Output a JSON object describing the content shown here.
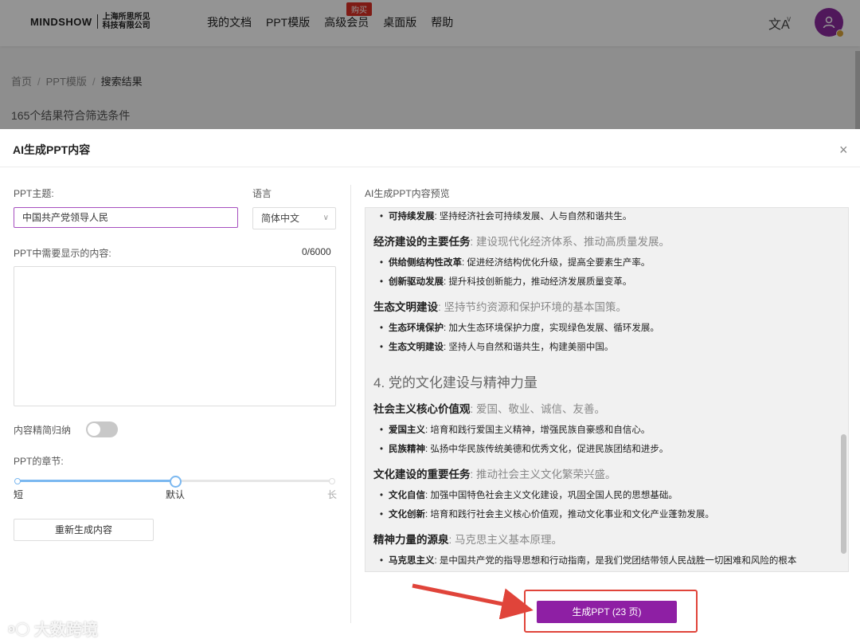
{
  "header": {
    "logo_brand": "MINDSHOW",
    "logo_company_line1": "上海所思所见",
    "logo_company_line2": "科技有限公司",
    "nav": [
      "我的文档",
      "PPT模版",
      "高级会员",
      "桌面版",
      "帮助"
    ],
    "buy_badge": "购买",
    "lang_icon": "文A",
    "lang_chevron": "∨"
  },
  "breadcrumb": {
    "home": "首页",
    "templates": "PPT模版",
    "current": "搜索结果"
  },
  "results": {
    "count_text": "165个结果符合筛选条件"
  },
  "modal": {
    "title": "AI生成PPT内容",
    "close": "×",
    "topic_label": "PPT主题:",
    "topic_value": "中国共产党领导人民",
    "language_label": "语言",
    "language_value": "简体中文",
    "content_label": "PPT中需要显示的内容:",
    "content_counter": "0/6000",
    "content_value": "",
    "simplify_label": "内容精简归纳",
    "simplify_on": false,
    "chapters_label": "PPT的章节:",
    "chapters_ticks": [
      "短",
      "默认",
      "长"
    ],
    "chapters_level": 0.5,
    "regen_button": "重新生成内容",
    "preview_label": "AI生成PPT内容预览",
    "generate_button": "生成PPT (23 页)"
  },
  "preview": [
    {
      "type": "bullet",
      "bold": "可持续发展",
      "text": ": 坚持经济社会可持续发展、人与自然和谐共生。"
    },
    {
      "type": "h3",
      "bold": "经济建设的主要任务",
      "text": ": 建设现代化经济体系、推动高质量发展。"
    },
    {
      "type": "bullet",
      "bold": "供给侧结构性改革",
      "text": ": 促进经济结构优化升级，提高全要素生产率。"
    },
    {
      "type": "bullet",
      "bold": "创新驱动发展",
      "text": ": 提升科技创新能力，推动经济发展质量变革。"
    },
    {
      "type": "h3",
      "bold": "生态文明建设",
      "text": ": 坚持节约资源和保护环境的基本国策。"
    },
    {
      "type": "bullet",
      "bold": "生态环境保护",
      "text": ": 加大生态环境保护力度，实现绿色发展、循环发展。"
    },
    {
      "type": "bullet",
      "bold": "生态文明建设",
      "text": ": 坚持人与自然和谐共生，构建美丽中国。"
    },
    {
      "type": "h2",
      "text": "4. 党的文化建设与精神力量"
    },
    {
      "type": "h3",
      "bold": "社会主义核心价值观",
      "text": ": 爱国、敬业、诚信、友善。"
    },
    {
      "type": "bullet",
      "bold": "爱国主义",
      "text": ": 培育和践行爱国主义精神，增强民族自豪感和自信心。"
    },
    {
      "type": "bullet",
      "bold": "民族精神",
      "text": ": 弘扬中华民族传统美德和优秀文化，促进民族团结和进步。"
    },
    {
      "type": "h3",
      "bold": "文化建设的重要任务",
      "text": ": 推动社会主义文化繁荣兴盛。"
    },
    {
      "type": "bullet",
      "bold": "文化自信",
      "text": ": 加强中国特色社会主义文化建设，巩固全国人民的思想基础。"
    },
    {
      "type": "bullet",
      "bold": "文化创新",
      "text": ": 培育和践行社会主义核心价值观，推动文化事业和文化产业蓬勃发展。"
    },
    {
      "type": "h3",
      "bold": "精神力量的源泉",
      "text": ": 马克思主义基本原理。"
    },
    {
      "type": "bullet",
      "bold": "马克思主义",
      "text": ": 是中国共产党的指导思想和行动指南，是我们党团结带领人民战胜一切困难和风险的根本"
    }
  ],
  "watermark": "大数跨境",
  "colors": {
    "accent": "#8e1fa4",
    "highlight": "#e0443a",
    "slider": "#7bb8f0"
  }
}
